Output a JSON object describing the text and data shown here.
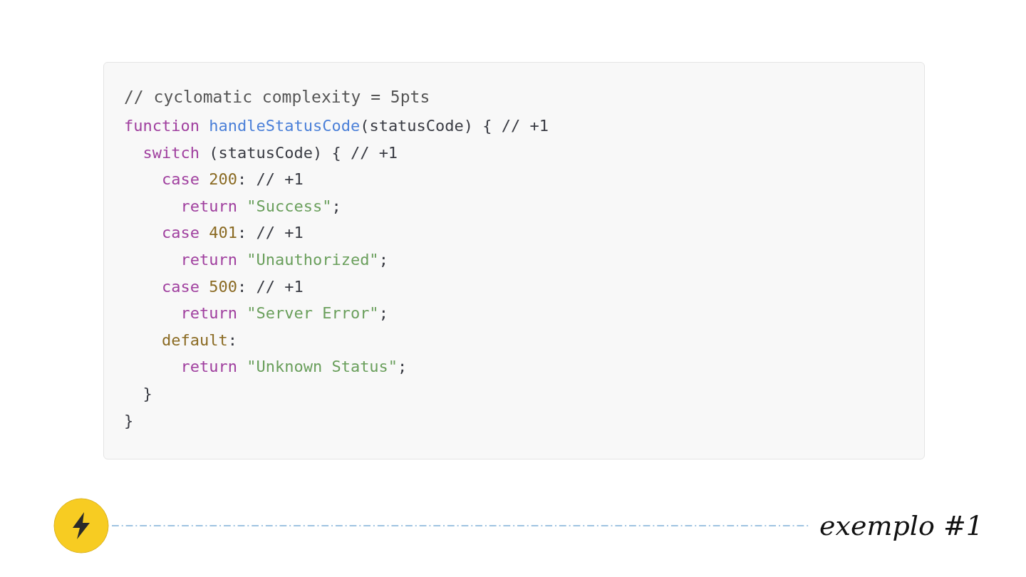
{
  "code_block": {
    "lines": [
      [
        {
          "kind": "comment",
          "text": "// cyclomatic complexity = 5pts"
        }
      ],
      [
        {
          "kind": "keyword",
          "text": "function "
        },
        {
          "kind": "function",
          "text": "handleStatusCode"
        },
        {
          "kind": "plain",
          "text": "(statusCode) { // +1"
        }
      ],
      [
        {
          "kind": "keyword",
          "text": "  switch"
        },
        {
          "kind": "plain",
          "text": " (statusCode) { // +1"
        }
      ],
      [
        {
          "kind": "keyword",
          "text": "    case "
        },
        {
          "kind": "number",
          "text": "200"
        },
        {
          "kind": "plain",
          "text": ": // +1"
        }
      ],
      [
        {
          "kind": "keyword",
          "text": "      return "
        },
        {
          "kind": "string",
          "text": "\"Success\""
        },
        {
          "kind": "plain",
          "text": ";"
        }
      ],
      [
        {
          "kind": "keyword",
          "text": "    case "
        },
        {
          "kind": "number",
          "text": "401"
        },
        {
          "kind": "plain",
          "text": ": // +1"
        }
      ],
      [
        {
          "kind": "keyword",
          "text": "      return "
        },
        {
          "kind": "string",
          "text": "\"Unauthorized\""
        },
        {
          "kind": "plain",
          "text": ";"
        }
      ],
      [
        {
          "kind": "keyword",
          "text": "    case "
        },
        {
          "kind": "number",
          "text": "500"
        },
        {
          "kind": "plain",
          "text": ": // +1"
        }
      ],
      [
        {
          "kind": "keyword",
          "text": "      return "
        },
        {
          "kind": "string",
          "text": "\"Server Error\""
        },
        {
          "kind": "plain",
          "text": ";"
        }
      ],
      [
        {
          "kind": "number",
          "text": "    default"
        },
        {
          "kind": "plain",
          "text": ":"
        }
      ],
      [
        {
          "kind": "keyword",
          "text": "      return "
        },
        {
          "kind": "string",
          "text": "\"Unknown Status\""
        },
        {
          "kind": "plain",
          "text": ";"
        }
      ],
      [
        {
          "kind": "plain",
          "text": "  }"
        }
      ],
      [
        {
          "kind": "plain",
          "text": "}"
        }
      ]
    ]
  },
  "footer": {
    "title": "exemplo #1"
  }
}
